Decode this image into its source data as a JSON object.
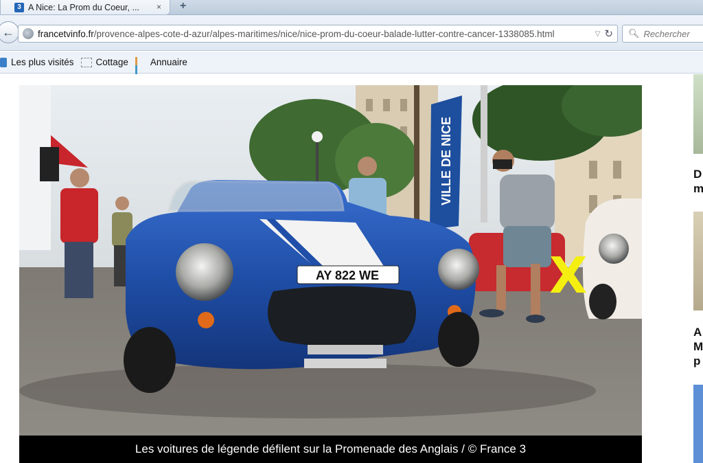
{
  "browser": {
    "tab_title": "A Nice: La Prom du Coeur, ...",
    "tab_close": "×",
    "new_tab": "+",
    "url_domain": "francetvinfo.fr",
    "url_path": "/provence-alpes-cote-d-azur/alpes-maritimes/nice/nice-prom-du-coeur-balade-lutter-contre-cancer-1338085.html",
    "search_placeholder": "Rechercher",
    "bookmarks": [
      "Les plus visités",
      "Cottage",
      "Annuaire"
    ]
  },
  "photo": {
    "caption": "Les voitures de légende défilent sur la Promenade des Anglais / © France 3",
    "banner_text": "VILLE DE NICE",
    "plate_text": "AY 822 WE",
    "marker": "X"
  },
  "sidebar": {
    "items": [
      {
        "lines": [
          "D",
          "m"
        ]
      },
      {
        "lines": [
          "A",
          "M",
          "p"
        ]
      }
    ]
  },
  "colors": {
    "car_blue": "#1f4fa8",
    "marker_yellow": "#f4ef10",
    "caption_bg": "#000000"
  }
}
